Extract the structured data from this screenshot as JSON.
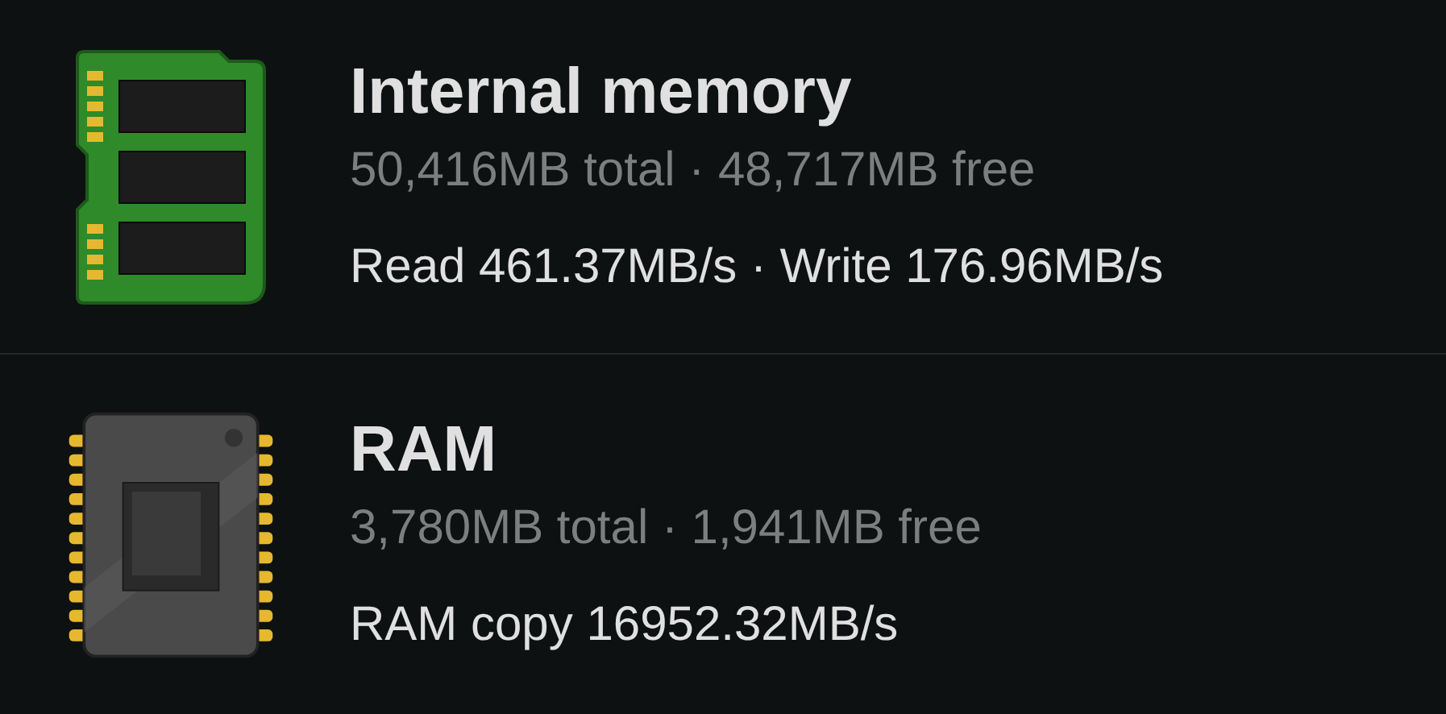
{
  "items": [
    {
      "kind": "storage",
      "title": "Internal memory",
      "summary": "50,416MB total · 48,717MB free",
      "speed": "Read 461.37MB/s · Write 176.96MB/s"
    },
    {
      "kind": "ram",
      "title": "RAM",
      "summary": "3,780MB total · 1,941MB free",
      "speed": "RAM copy 16952.32MB/s"
    }
  ]
}
